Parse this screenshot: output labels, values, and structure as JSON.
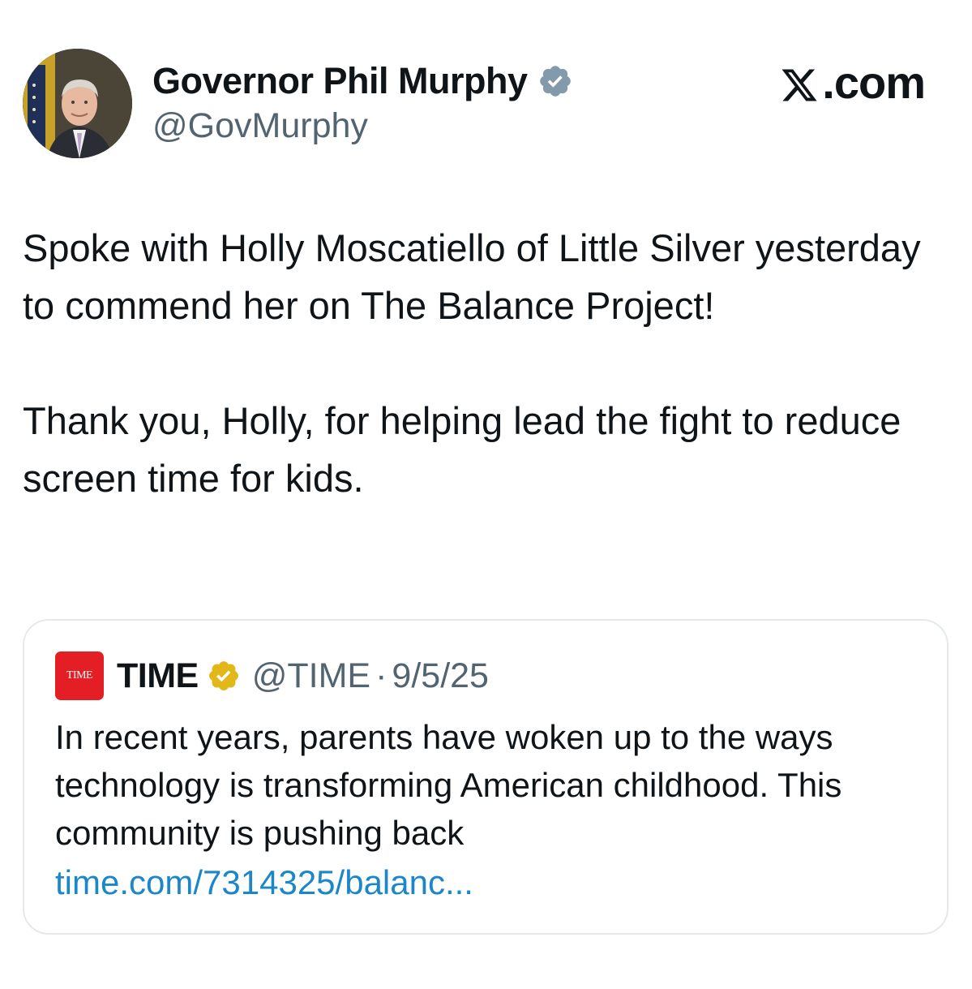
{
  "author": {
    "display_name": "Governor Phil Murphy",
    "handle": "@GovMurphy",
    "avatar_icon": "profile-photo",
    "verified_badge": "gray-verified-icon"
  },
  "brand": {
    "label": ".com",
    "icon": "x-logo-icon"
  },
  "tweet": {
    "paragraph_1": "Spoke with Holly Moscatiello of Little Silver yesterday to commend her on The Balance Project!",
    "paragraph_2": "Thank you, Holly, for helping lead the fight to reduce screen time for kids."
  },
  "quote": {
    "logo_text": "TIME",
    "display_name": "TIME",
    "verified_badge": "gold-verified-icon",
    "handle": "@TIME",
    "separator": "·",
    "date": "9/5/25",
    "text": "In recent years, parents have woken up to the ways technology is transforming American childhood. This community is pushing back",
    "link": "time.com/7314325/balanc..."
  },
  "colors": {
    "text": "#0f1419",
    "secondary": "#536471",
    "link": "#1b87c8",
    "time_red": "#e31e24",
    "gold": "#e2b719",
    "verified_gray": "#829aab"
  }
}
